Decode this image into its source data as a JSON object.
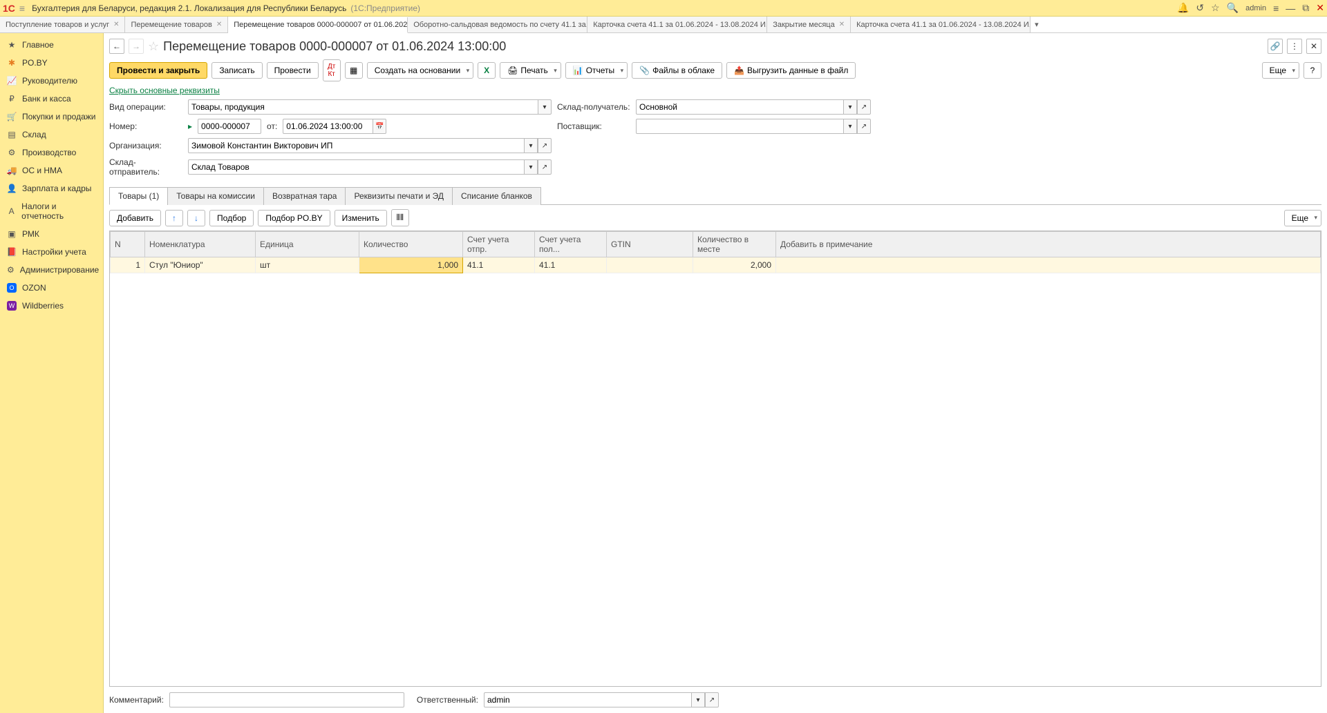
{
  "titlebar": {
    "app_name": "Бухгалтерия для Беларуси, редакция 2.1. Локализация для Республики Беларусь",
    "suffix": "(1С:Предприятие)",
    "username": "admin"
  },
  "tabs": [
    {
      "label": "Поступление товаров и услуг",
      "active": false
    },
    {
      "label": "Перемещение товаров",
      "active": false
    },
    {
      "label": "Перемещение товаров 0000-000007 от 01.06.202...",
      "active": true
    },
    {
      "label": "Оборотно-сальдовая ведомость по счету 41.1 за...",
      "active": false
    },
    {
      "label": "Карточка счета 41.1 за 01.06.2024 - 13.08.2024 И...",
      "active": false
    },
    {
      "label": "Закрытие месяца",
      "active": false
    },
    {
      "label": "Карточка счета 41.1 за 01.06.2024 - 13.08.2024 И...",
      "active": false
    }
  ],
  "sidebar": [
    {
      "label": "Главное",
      "icon": "home"
    },
    {
      "label": "PO.BY",
      "icon": "poby"
    },
    {
      "label": "Руководителю",
      "icon": "chart"
    },
    {
      "label": "Банк и касса",
      "icon": "coin"
    },
    {
      "label": "Покупки и продажи",
      "icon": "cart"
    },
    {
      "label": "Склад",
      "icon": "barcode"
    },
    {
      "label": "Производство",
      "icon": "factory"
    },
    {
      "label": "ОС и НМА",
      "icon": "truck"
    },
    {
      "label": "Зарплата и кадры",
      "icon": "person"
    },
    {
      "label": "Налоги и отчетность",
      "icon": "tax"
    },
    {
      "label": "РМК",
      "icon": "pos"
    },
    {
      "label": "Настройки учета",
      "icon": "book"
    },
    {
      "label": "Администрирование",
      "icon": "gear"
    },
    {
      "label": "OZON",
      "icon": "ozon"
    },
    {
      "label": "Wildberries",
      "icon": "wb"
    }
  ],
  "doc": {
    "title": "Перемещение товаров 0000-000007 от 01.06.2024 13:00:00",
    "hide_details": "Скрыть основные реквизиты"
  },
  "toolbar": {
    "post_close": "Провести и закрыть",
    "save": "Записать",
    "post": "Провести",
    "create_based": "Создать на основании",
    "print": "Печать",
    "reports": "Отчеты",
    "files": "Файлы в облаке",
    "export": "Выгрузить данные в файл",
    "more": "Еще"
  },
  "form": {
    "operation_label": "Вид операции:",
    "operation_value": "Товары, продукция",
    "number_label": "Номер:",
    "number_value": "0000-000007",
    "date_label": "от:",
    "date_value": "01.06.2024 13:00:00",
    "org_label": "Организация:",
    "org_value": "Зимовой Константин Викторович ИП",
    "warehouse_from_label": "Склад-отправитель:",
    "warehouse_from_value": "Склад Товаров",
    "warehouse_to_label": "Склад-получатель:",
    "warehouse_to_value": "Основной",
    "supplier_label": "Поставщик:",
    "supplier_value": ""
  },
  "inner_tabs": [
    {
      "label": "Товары (1)",
      "active": true
    },
    {
      "label": "Товары на комиссии",
      "active": false
    },
    {
      "label": "Возвратная тара",
      "active": false
    },
    {
      "label": "Реквизиты печати и ЭД",
      "active": false
    },
    {
      "label": "Списание бланков",
      "active": false
    }
  ],
  "table_toolbar": {
    "add": "Добавить",
    "pick": "Подбор",
    "pick_poby": "Подбор PO.BY",
    "change": "Изменить",
    "more": "Еще"
  },
  "table": {
    "headers": [
      "N",
      "Номенклатура",
      "Единица",
      "Количество",
      "Счет учета отпр.",
      "Счет учета пол...",
      "GTIN",
      "Количество в месте",
      "Добавить в примечание"
    ],
    "rows": [
      {
        "n": "1",
        "nom": "Стул \"Юниор\"",
        "unit": "шт",
        "qty": "1,000",
        "acc_from": "41.1",
        "acc_to": "41.1",
        "gtin": "",
        "qty_place": "2,000",
        "note": ""
      }
    ]
  },
  "footer": {
    "comment_label": "Комментарий:",
    "comment_value": "",
    "resp_label": "Ответственный:",
    "resp_value": "admin"
  }
}
